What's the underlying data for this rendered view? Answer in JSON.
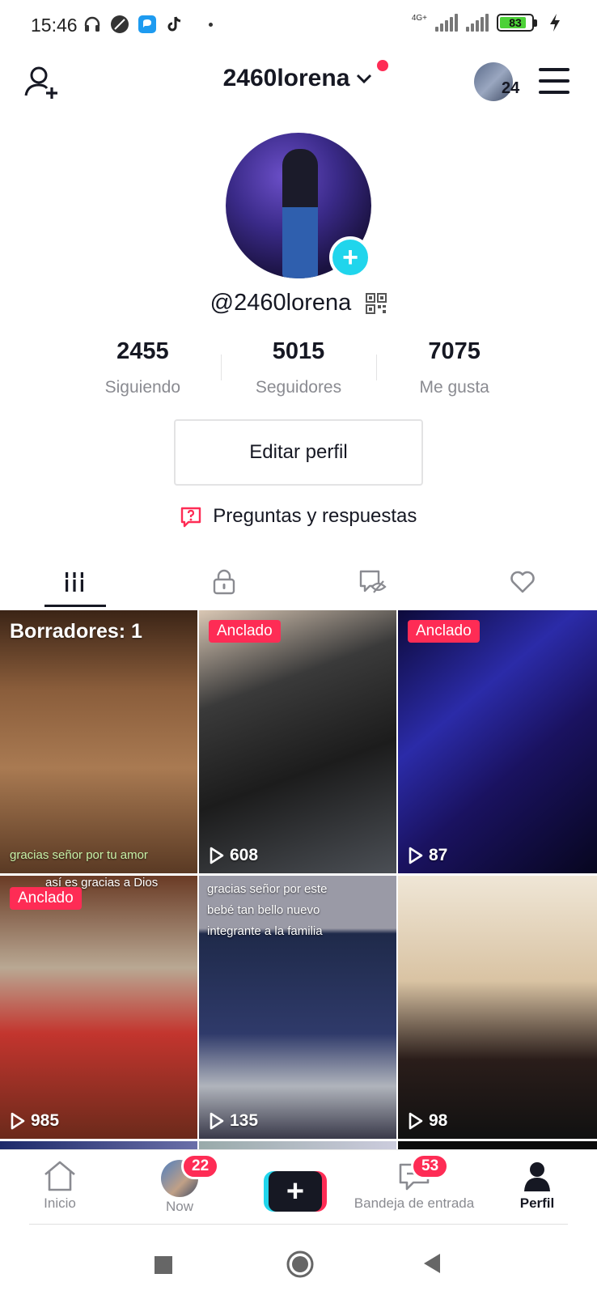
{
  "status_bar": {
    "time": "15:46",
    "network": "4G+",
    "battery": "83"
  },
  "header": {
    "username": "2460lorena",
    "friends_count": "24"
  },
  "profile": {
    "handle": "@2460lorena",
    "stats": [
      {
        "value": "2455",
        "label": "Siguiendo"
      },
      {
        "value": "5015",
        "label": "Seguidores"
      },
      {
        "value": "7075",
        "label": "Me gusta"
      }
    ],
    "edit_button": "Editar perfil",
    "qa_link": "Preguntas y respuestas"
  },
  "tabs": [
    "videos-grid",
    "private",
    "reposts-hidden",
    "liked"
  ],
  "grid": {
    "drafts_label": "Borradores: 1",
    "drafts_caption": "gracias señor por tu amor",
    "pinned_label": "Anclado",
    "videos": [
      {
        "views": "608"
      },
      {
        "views": "87"
      },
      {
        "views": "985",
        "top_text": "así es gracias a Dios"
      },
      {
        "views": "135",
        "top_text": "gracias señor por este bebé tan bello nuevo integrante a la familia"
      },
      {
        "views": "98"
      }
    ]
  },
  "bottom_nav": {
    "home": "Inicio",
    "now": "Now",
    "now_badge": "22",
    "inbox": "Bandeja de entrada",
    "inbox_badge": "53",
    "profile": "Perfil"
  },
  "colors": {
    "accent": "#fe2c55",
    "cyan": "#20d5ec",
    "text": "#161823",
    "muted": "#8a8b91"
  }
}
